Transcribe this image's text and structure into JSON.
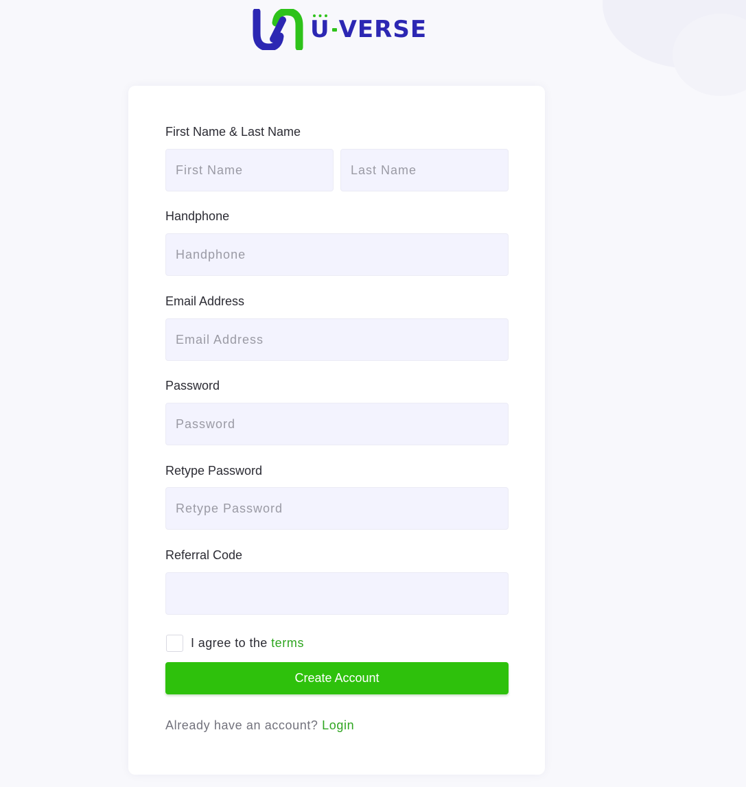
{
  "brand": {
    "logo_text_first": "U",
    "logo_text_rest": "VERSE",
    "primary_color": "#2c27b3",
    "accent_color": "#2ec21a"
  },
  "form": {
    "name_label": "First Name & Last Name",
    "first_name_placeholder": "First Name",
    "last_name_placeholder": "Last Name",
    "handphone_label": "Handphone",
    "handphone_placeholder": "Handphone",
    "email_label": "Email Address",
    "email_placeholder": "Email Address",
    "password_label": "Password",
    "password_placeholder": "Password",
    "retype_password_label": "Retype Password",
    "retype_password_placeholder": "Retype Password",
    "referral_label": "Referral Code",
    "referral_placeholder": "",
    "terms_prefix": "I agree to the ",
    "terms_link": "terms",
    "submit_label": "Create Account",
    "login_prompt": "Already have an account? ",
    "login_link": "Login"
  }
}
